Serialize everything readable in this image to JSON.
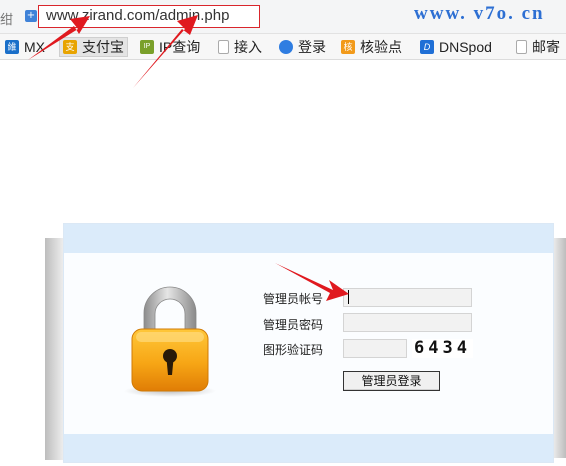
{
  "browser": {
    "left_icon": "绀",
    "url": "www.zirand.com/admin.php",
    "url_host": "www.zirand.com",
    "url_path": "/admin.php",
    "watermark": "www. v7o. cn"
  },
  "bookmarks": [
    {
      "label": "MX",
      "icon": "mx-icon",
      "color": "#1a6fc9",
      "glyph": "維"
    },
    {
      "label": "支付宝",
      "icon": "alipay-icon",
      "color": "#e8a400",
      "glyph": "支"
    },
    {
      "label": "IP查询",
      "icon": "ip-icon",
      "color": "#7aa02a",
      "glyph": "IP"
    },
    {
      "label": "接入",
      "icon": "page-icon",
      "color": "#ffffff",
      "glyph": ""
    },
    {
      "label": "登录",
      "icon": "cloud-icon",
      "color": "#2f7de1",
      "glyph": ""
    },
    {
      "label": "核验点",
      "icon": "check-icon",
      "color": "#f29a1a",
      "glyph": "核"
    },
    {
      "label": "DNSpod",
      "icon": "dnspod-icon",
      "color": "#1f6fd6",
      "glyph": "D"
    },
    {
      "label": "邮寄",
      "icon": "page-icon",
      "color": "#ffffff",
      "glyph": ""
    }
  ],
  "login": {
    "username_label": "管理员帐号",
    "password_label": "管理员密码",
    "captcha_label": "图形验证码",
    "username_value": "",
    "password_value": "",
    "captcha_value": "",
    "captcha_image_text": "6434",
    "submit_label": "管理员登录"
  },
  "colors": {
    "accent": "#dbebfa",
    "url_highlight": "#d9262c",
    "arrow": "#e0191f"
  }
}
